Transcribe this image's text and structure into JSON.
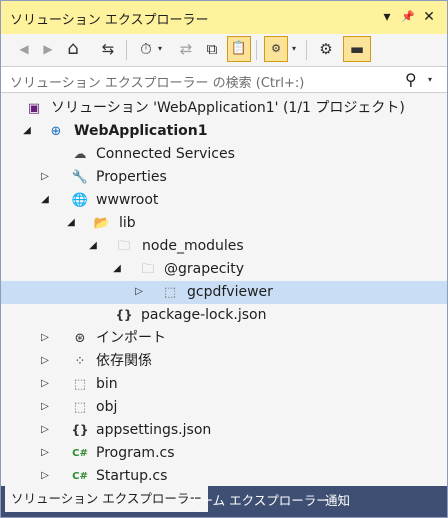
{
  "window": {
    "title": "ソリューション エクスプローラー",
    "dropdown_glyph": "▾",
    "pin_glyph": "📌",
    "close_glyph": "✕"
  },
  "toolbar": {
    "back_glyph": "◀",
    "forward_glyph": "▶",
    "home_glyph": "⌂",
    "switch_views_glyph": "⇆",
    "pending_changes_glyph": "⏱",
    "dropdown_glyph": "▾",
    "sync_glyph": "⇄",
    "collapse_all_glyph": "⧉",
    "show_all_files_glyph": "📋",
    "properties_glyph": "⚙",
    "preview_glyph": "▬"
  },
  "search": {
    "placeholder": "ソリューション エクスプローラー の検索 (Ctrl+:)",
    "search_glyph": "⚲",
    "dropdown_glyph": "▾"
  },
  "tree": {
    "rows": [
      {
        "label": "ソリューション 'WebApplication1' (1/1 プロジェクト)",
        "arrow": "",
        "icon": "▣",
        "icon_color": "#68217a"
      },
      {
        "label": "WebApplication1",
        "arrow": "◢",
        "icon": "⊕",
        "icon_color": "#1a6fc2"
      },
      {
        "label": "Connected Services",
        "arrow": "",
        "icon": "☁",
        "icon_color": "#4a4a4a"
      },
      {
        "label": "Properties",
        "arrow": "▷",
        "icon": "🔧",
        "icon_color": "#c58b1c"
      },
      {
        "label": "wwwroot",
        "arrow": "◢",
        "icon": "🌐",
        "icon_color": "#333333"
      },
      {
        "label": "lib",
        "arrow": "◢",
        "icon": "📂",
        "icon_color": "#dcb67a"
      },
      {
        "label": "node_modules",
        "arrow": "◢",
        "icon": "🗀",
        "icon_color": "#9a9a9a"
      },
      {
        "label": "@grapecity",
        "arrow": "◢",
        "icon": "🗀",
        "icon_color": "#9a9a9a"
      },
      {
        "label": "gcpdfviewer",
        "arrow": "▷",
        "icon": "⬚",
        "icon_color": "#6d6d6d"
      },
      {
        "label": "package-lock.json",
        "arrow": "",
        "icon": "{}",
        "icon_color": "#333333"
      },
      {
        "label": "インポート",
        "arrow": "▷",
        "icon": "⊛",
        "icon_color": "#333333"
      },
      {
        "label": "依存関係",
        "arrow": "▷",
        "icon": "⁘",
        "icon_color": "#333333"
      },
      {
        "label": "bin",
        "arrow": "▷",
        "icon": "⬚",
        "icon_color": "#6d6d6d"
      },
      {
        "label": "obj",
        "arrow": "▷",
        "icon": "⬚",
        "icon_color": "#6d6d6d"
      },
      {
        "label": "appsettings.json",
        "arrow": "▷",
        "icon": "{}",
        "icon_color": "#333333"
      },
      {
        "label": "Program.cs",
        "arrow": "▷",
        "icon": "C#",
        "icon_color": "#2e8b2e"
      },
      {
        "label": "Startup.cs",
        "arrow": "▷",
        "icon": "C#",
        "icon_color": "#2e8b2e"
      }
    ]
  },
  "tabs": [
    {
      "label": "ソリューション エクスプローラー"
    },
    {
      "label": "チーム エクスプローラー"
    },
    {
      "label": "通知"
    }
  ],
  "colors": {
    "title_bar": "#fff29d",
    "tab_strip": "#3f4f73",
    "selection": "#c9def5"
  }
}
